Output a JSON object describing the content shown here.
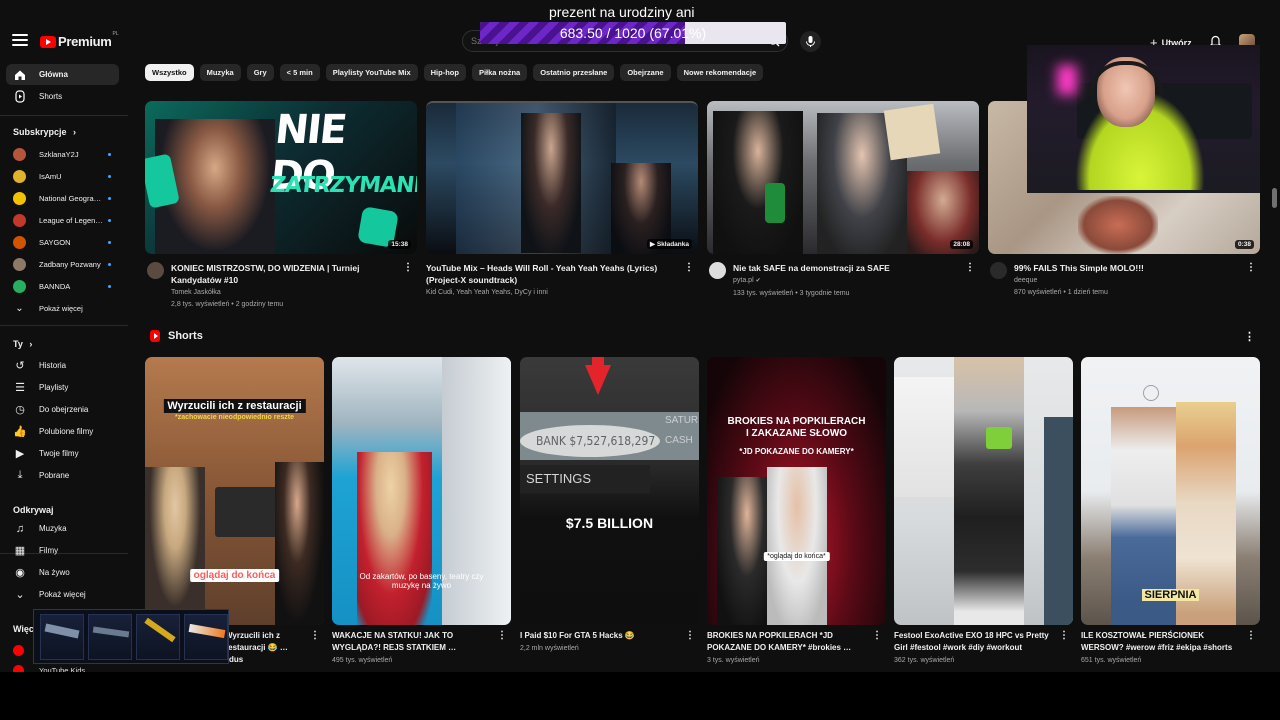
{
  "overlay": {
    "title": "prezent na urodziny ani",
    "progress_text": "683.50 / 1020 (67.01%)",
    "progress_fraction": 0.6701
  },
  "header": {
    "logo_text": "Premium",
    "logo_sup": "PL",
    "search_placeholder": "Szukaj",
    "create_label": "Utwórz"
  },
  "sidebar": {
    "main": [
      {
        "label": "Główna",
        "icon": "home-icon"
      },
      {
        "label": "Shorts",
        "icon": "shorts-icon"
      }
    ],
    "subscriptions_title": "Subskrypcje",
    "subscriptions": [
      {
        "label": "SzklanaY2J",
        "color": "#b5563c"
      },
      {
        "label": "IsAmU",
        "color": "#e0b22c"
      },
      {
        "label": "National Geogra…",
        "color": "#f2c200"
      },
      {
        "label": "League of Legen…",
        "color": "#c0392b"
      },
      {
        "label": "SAYGON",
        "color": "#d35400"
      },
      {
        "label": "Zadbany Pozwany",
        "color": "#8e7866"
      },
      {
        "label": "BANNDA",
        "color": "#27ae60"
      }
    ],
    "show_more": "Pokaż więcej",
    "you_title": "Ty",
    "you_items": [
      {
        "label": "Historia",
        "icon": "history-icon"
      },
      {
        "label": "Playlisty",
        "icon": "playlist-icon"
      },
      {
        "label": "Do obejrzenia",
        "icon": "clock-icon"
      },
      {
        "label": "Polubione filmy",
        "icon": "thumb-up-icon"
      },
      {
        "label": "Twoje filmy",
        "icon": "video-icon"
      },
      {
        "label": "Pobrane",
        "icon": "download-icon"
      }
    ],
    "explore_title": "Odkrywaj",
    "explore_items": [
      {
        "label": "Muzyka",
        "icon": "music-icon"
      },
      {
        "label": "Filmy",
        "icon": "film-icon"
      },
      {
        "label": "Na żywo",
        "icon": "live-icon"
      },
      {
        "label": "Pokaż więcej",
        "icon": "chevron-down-icon"
      }
    ],
    "more_title": "Więc",
    "kids_label": "YouTube Kids"
  },
  "chips": [
    "Wszystko",
    "Muzyka",
    "Gry",
    "< 5 min",
    "Playlisty YouTube Mix",
    "Hip-hop",
    "Piłka nożna",
    "Ostatnio przesłane",
    "Obejrzane",
    "Nowe rekomendacje"
  ],
  "videos": [
    {
      "title": "KONIEC MISTRZOSTW, DO WIDZENIA | Turniej Kandydatów #10",
      "channel": "Tomek Jaskółka",
      "stats": "2,8 tys. wyświetleń • 2 godziny temu",
      "duration": "15:38",
      "thumb_text1": "NIE DO",
      "thumb_text2": "ZATRZYMANIA"
    },
    {
      "title": "YouTube Mix – Heads Will Roll - Yeah Yeah Yeahs (Lyrics) (Project-X soundtrack)",
      "channel": "Kid Cudi, Yeah Yeah Yeahs, DyCy i inni",
      "stats": "",
      "duration": "Składanka"
    },
    {
      "title": "Nie tak SAFE na demonstracji za SAFE",
      "channel": "pyta.pl",
      "stats": "133 tys. wyświetleń • 3 tygodnie temu",
      "duration": "28:08"
    },
    {
      "title": "99% FAILS This Simple MOLO!!!",
      "channel": "deeque",
      "stats": "870 wyświetleń • 1 dzień temu",
      "duration": "0:38"
    }
  ],
  "shorts_title": "Shorts",
  "shorts": [
    {
      "title": "Wyrzucili ich z restauracji 😂 … zdus",
      "stats": "",
      "cap1": "Wyrzucili ich z restauracji",
      "cap2": "*zachowacie nieodpowiednio reszte",
      "cap3": "oglądaj do końca"
    },
    {
      "title": "WAKACJE NA STATKU! JAK TO WYGLĄDA?! REJS STATKIEM …",
      "stats": "495 tys. wyświetleń",
      "cap1": "Od zakartów, po baseny, teatry czy muzykę na żywo"
    },
    {
      "title": "I Paid $10 For GTA 5 Hacks 😂",
      "stats": "2,2 mln wyświetleń",
      "cap1": "BANK $7,527,618,297",
      "cap2": "SETTINGS",
      "cap3": "$7.5 BILLION",
      "cap4": "SATUR",
      "cap5": "CASH"
    },
    {
      "title": "BROKIES NA POPKILERACH *JD POKAZANE DO KAMERY* #brokies …",
      "stats": "3 tys. wyświetleń",
      "cap1": "BROKIES NA POPKILERACH",
      "cap2": "I ZAKAZANE SŁOWO",
      "cap3": "*JD POKAZANE DO KAMERY*",
      "cap4": "*oglądaj do końca*"
    },
    {
      "title": "Festool ExoActive EXO 18 HPC vs Pretty Girl #festool #work #diy #workout",
      "stats": "362 tys. wyświetleń"
    },
    {
      "title": "ILE KOSZTOWAŁ PIERŚCIONEK WERSOW? #werow #friz #ekipa #shorts",
      "stats": "651 tys. wyświetleń",
      "cap1": "SIERPNIA"
    }
  ]
}
